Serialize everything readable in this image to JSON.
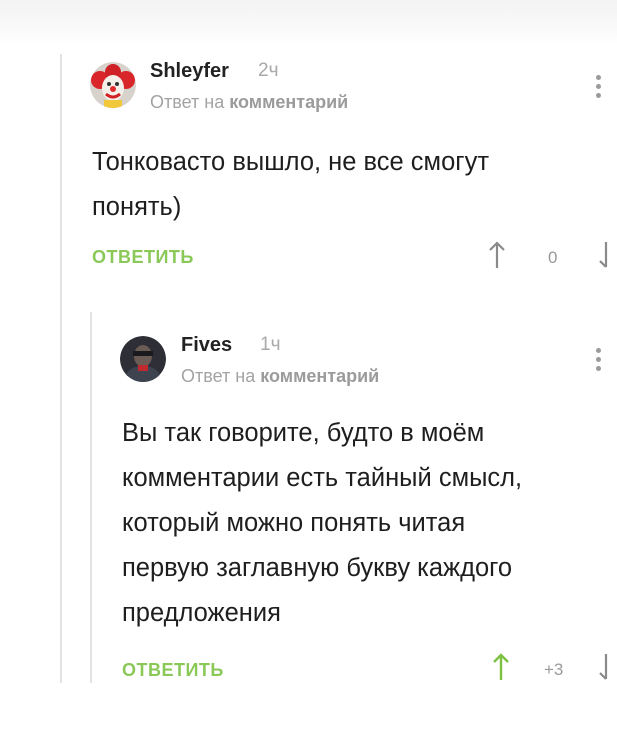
{
  "comments": [
    {
      "author": "Shleyfer",
      "time": "2ч",
      "reply_prefix": "Ответ на",
      "reply_target": "комментарий",
      "body_lines": [
        "Тонковасто вышло, не все смогут",
        "понять)"
      ],
      "reply_label": "ОТВЕТИТЬ",
      "score": "0"
    },
    {
      "author": "Fives",
      "time": "1ч",
      "reply_prefix": "Ответ на",
      "reply_target": "комментарий",
      "body_lines": [
        "Вы так говорите, будто в моём",
        "комментарии есть тайный смысл,",
        "который можно понять читая",
        "первую заглавную букву каждого",
        "предложения"
      ],
      "reply_label": "ОТВЕТИТЬ",
      "score": "+3"
    }
  ],
  "colors": {
    "reply_button": "#8ac858",
    "muted_text": "#a3a3a3",
    "thread_line": "#e2e2e2"
  },
  "icons": {
    "upvote": "arrow-up-icon",
    "downvote": "arrow-down-icon",
    "menu": "vertical-dots-icon"
  }
}
